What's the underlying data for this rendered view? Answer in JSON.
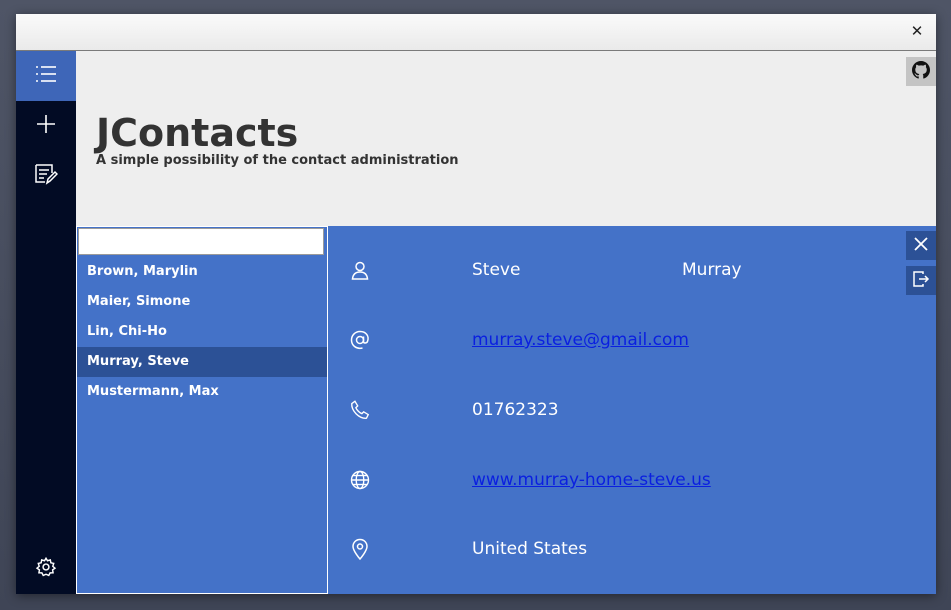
{
  "window": {
    "close_label": "✕"
  },
  "sidebar": {
    "items": [
      {
        "name": "contact-list",
        "icon": "list-icon",
        "active": true
      },
      {
        "name": "add-contact",
        "icon": "plus-icon",
        "active": false
      },
      {
        "name": "notes",
        "icon": "edit-note-icon",
        "active": false
      }
    ],
    "settings_icon": "gear-icon"
  },
  "header": {
    "title": "JContacts",
    "subtitle": "A simple possibility of the contact administration",
    "github_icon": "github-icon"
  },
  "contacts": {
    "search_value": "",
    "items": [
      "Brown, Marylin",
      "Maier, Simone",
      "Lin, Chi-Ho",
      "Murray, Steve",
      "Mustermann, Max"
    ],
    "selected_index": 3
  },
  "detail": {
    "first_name": "Steve",
    "last_name": "Murray",
    "email": "murray.steve@gmail.com",
    "phone": "01762323",
    "website": "www.murray-home-steve.us",
    "country": "United States",
    "actions": {
      "close_icon": "close-icon",
      "export_icon": "export-icon"
    }
  },
  "colors": {
    "sidebar_bg": "#020b24",
    "accent_blue": "#4472c8",
    "selected_blue": "#2c5196",
    "link_blue": "#0a1fe0"
  }
}
